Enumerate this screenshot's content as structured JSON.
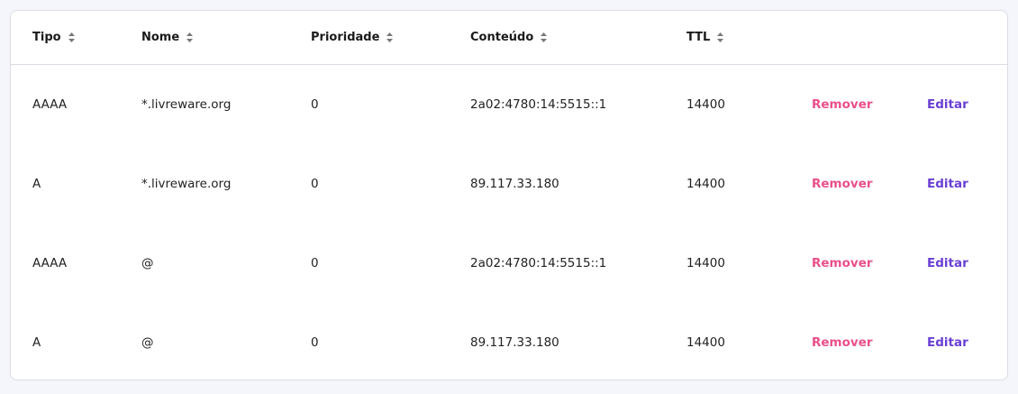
{
  "table": {
    "headers": {
      "tipo": "Tipo",
      "nome": "Nome",
      "prioridade": "Prioridade",
      "conteudo": "Conteúdo",
      "ttl": "TTL"
    },
    "rows": [
      {
        "tipo": "AAAA",
        "nome": "*.livreware.org",
        "prioridade": "0",
        "conteudo": "2a02:4780:14:5515::1",
        "ttl": "14400",
        "remove": "Remover",
        "edit": "Editar"
      },
      {
        "tipo": "A",
        "nome": "*.livreware.org",
        "prioridade": "0",
        "conteudo": "89.117.33.180",
        "ttl": "14400",
        "remove": "Remover",
        "edit": "Editar"
      },
      {
        "tipo": "AAAA",
        "nome": "@",
        "prioridade": "0",
        "conteudo": "2a02:4780:14:5515::1",
        "ttl": "14400",
        "remove": "Remover",
        "edit": "Editar"
      },
      {
        "tipo": "A",
        "nome": "@",
        "prioridade": "0",
        "conteudo": "89.117.33.180",
        "ttl": "14400",
        "remove": "Remover",
        "edit": "Editar"
      }
    ]
  },
  "icons": {
    "sort": "sort-icon"
  },
  "colors": {
    "remove": "#ea4f8b",
    "edit": "#6a3fd4",
    "background": "#f5f5fc"
  }
}
